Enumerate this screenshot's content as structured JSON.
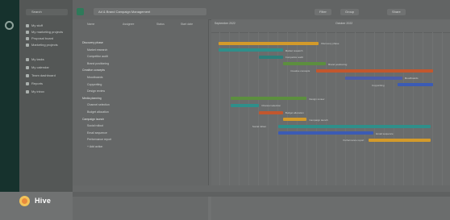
{
  "app": {
    "name": "Hive"
  },
  "sidebar": {
    "search_placeholder": "Search",
    "items": [
      {
        "label": "My stuff"
      },
      {
        "label": "My marketing projects"
      },
      {
        "label": "Proposal board"
      },
      {
        "label": "Marketing projects"
      },
      {
        "label": "My tasks"
      },
      {
        "label": "My calendar"
      },
      {
        "label": "Team dashboard"
      },
      {
        "label": "Reports"
      },
      {
        "label": "My inbox"
      }
    ]
  },
  "toolbar": {
    "project_name": "Ad & Brand Campaign Management",
    "buttons": [
      "Filter",
      "Group",
      "Share"
    ]
  },
  "table": {
    "headers": [
      "Name",
      "Assignee",
      "Status",
      "Start date"
    ],
    "rows": [
      {
        "name": "Discovery phase",
        "group": true
      },
      {
        "name": "Market research",
        "group": false
      },
      {
        "name": "Competitor audit",
        "group": false
      },
      {
        "name": "Brand positioning",
        "group": false
      },
      {
        "name": "Creative concepts",
        "group": true
      },
      {
        "name": "Moodboards",
        "group": false
      },
      {
        "name": "Copywriting",
        "group": false
      },
      {
        "name": "Design review",
        "group": false
      },
      {
        "name": "Media planning",
        "group": true
      },
      {
        "name": "Channel selection",
        "group": false
      },
      {
        "name": "Budget allocation",
        "group": false
      },
      {
        "name": "Campaign launch",
        "group": true
      },
      {
        "name": "Social rollout",
        "group": false
      },
      {
        "name": "Email sequence",
        "group": false
      },
      {
        "name": "Performance report",
        "group": false
      }
    ],
    "add_row": "+ Add action"
  },
  "gantt": {
    "months": [
      "September 2022",
      "October 2022"
    ],
    "bars": [
      {
        "label": "Discovery phase",
        "color": "#d39a2a",
        "row": 0,
        "start": 0.03,
        "end": 0.45
      },
      {
        "label": "Market research",
        "color": "#2f8f8a",
        "row": 1,
        "start": 0.03,
        "end": 0.3
      },
      {
        "label": "Competitor audit",
        "color": "#2c7f7a",
        "row": 2,
        "start": 0.2,
        "end": 0.3
      },
      {
        "label": "Brand positioning",
        "color": "#5c8f3e",
        "row": 3,
        "start": 0.3,
        "end": 0.48
      },
      {
        "label": "Creative concepts",
        "color": "#c2572e",
        "row": 4,
        "start": 0.44,
        "end": 0.93
      },
      {
        "label": "Moodboards",
        "color": "#4c5da8",
        "row": 5,
        "start": 0.56,
        "end": 0.8
      },
      {
        "label": "Copywriting",
        "color": "#3b5bb5",
        "row": 6,
        "start": 0.78,
        "end": 0.93
      },
      {
        "label": "Design review",
        "color": "#5c8f3e",
        "row": 8,
        "start": 0.08,
        "end": 0.4
      },
      {
        "label": "Channel selection",
        "color": "#2f8f8a",
        "row": 9,
        "start": 0.08,
        "end": 0.2
      },
      {
        "label": "Budget allocation",
        "color": "#c2572e",
        "row": 10,
        "start": 0.2,
        "end": 0.3
      },
      {
        "label": "Campaign launch",
        "color": "#d39a2a",
        "row": 11,
        "start": 0.3,
        "end": 0.4
      },
      {
        "label": "Social rollout",
        "color": "#2f8f8a",
        "row": 12,
        "start": 0.28,
        "end": 0.92
      },
      {
        "label": "Email sequence",
        "color": "#3b5bb5",
        "row": 13,
        "start": 0.28,
        "end": 0.68
      },
      {
        "label": "Performance report",
        "color": "#d39a2a",
        "row": 14,
        "start": 0.66,
        "end": 0.92
      }
    ]
  }
}
